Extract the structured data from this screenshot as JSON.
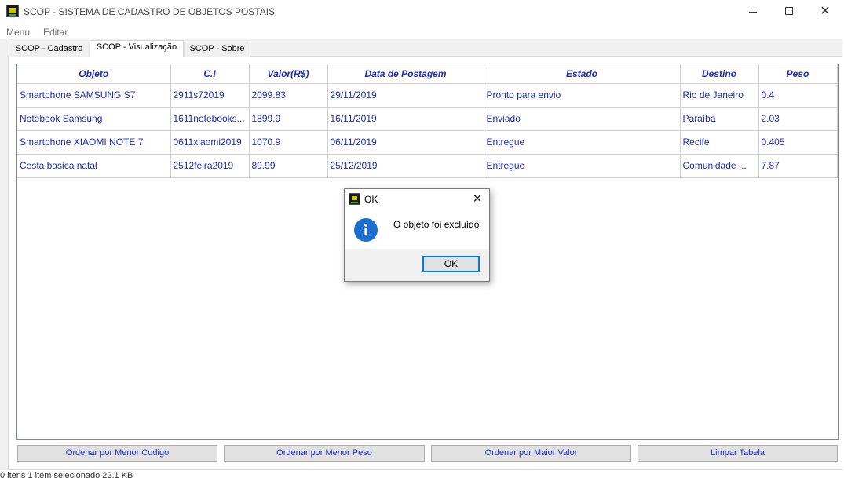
{
  "window": {
    "title": "SCOP - SISTEMA DE CADASTRO DE OBJETOS POSTAIS"
  },
  "menu": [
    "Menu",
    "Editar"
  ],
  "tabs": [
    {
      "label": "SCOP - Cadastro",
      "active": false
    },
    {
      "label": "SCOP - Visualização",
      "active": true
    },
    {
      "label": "SCOP - Sobre",
      "active": false
    }
  ],
  "table": {
    "columns": [
      "Objeto",
      "C.I",
      "Valor(R$)",
      "Data de Postagem",
      "Estado",
      "Destino",
      "Peso"
    ],
    "rows": [
      [
        "Smartphone SAMSUNG S7",
        "2911s72019",
        "2099.83",
        "29/11/2019",
        "Pronto para envio",
        "Rio de Janeiro",
        "0.4"
      ],
      [
        "Notebook Samsung",
        "1611notebooks...",
        "1899.9",
        "16/11/2019",
        "Enviado",
        "Paraíba",
        "2.03"
      ],
      [
        "Smartphone XIAOMI NOTE 7",
        "0611xiaomi2019",
        "1070.9",
        "06/11/2019",
        "Entregue",
        "Recife",
        "0.405"
      ],
      [
        "Cesta basica natal",
        "2512feira2019",
        "89.99",
        "25/12/2019",
        "Entregue",
        "Comunidade ...",
        "7.87"
      ]
    ]
  },
  "buttons": {
    "sort_code": "Ordenar por Menor Codigo",
    "sort_weight": "Ordenar por Menor Peso",
    "sort_value": "Ordenar por Maior Valor",
    "clear_table": "Limpar Tabela"
  },
  "status_bar": "0 itens      1 item selecionado  22,1 KB",
  "dialog": {
    "title": "OK",
    "message": "O objeto foi excluído",
    "ok_label": "OK",
    "icon": "info-icon"
  },
  "colors": {
    "table_text": "#1f2db8",
    "info_icon": "#1a6fd0",
    "focus_border": "#0078d7"
  }
}
